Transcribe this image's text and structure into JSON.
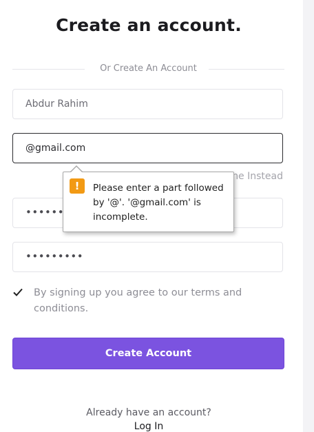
{
  "page": {
    "title": "Create an account.",
    "divider_text": "Or Create An Account"
  },
  "form": {
    "name_value": "Abdur Rahim",
    "email_value": "@gmail.com",
    "phone_link_partial": "ne Instead",
    "password_mask": "•••••••••",
    "confirm_password_mask": "•••••••••",
    "terms_checked": true,
    "terms_label": "By signing up you agree to our terms and conditions.",
    "submit_label": "Create Account"
  },
  "validation_tooltip": {
    "icon": "warning-icon",
    "icon_glyph": "!",
    "message": "Please enter a part followed by '@'. '@gmail.com' is incomplete."
  },
  "footer": {
    "prompt": "Already have an account?",
    "login_label": "Log In"
  },
  "colors": {
    "accent": "#7b53e0",
    "warning": "#f29a14"
  }
}
